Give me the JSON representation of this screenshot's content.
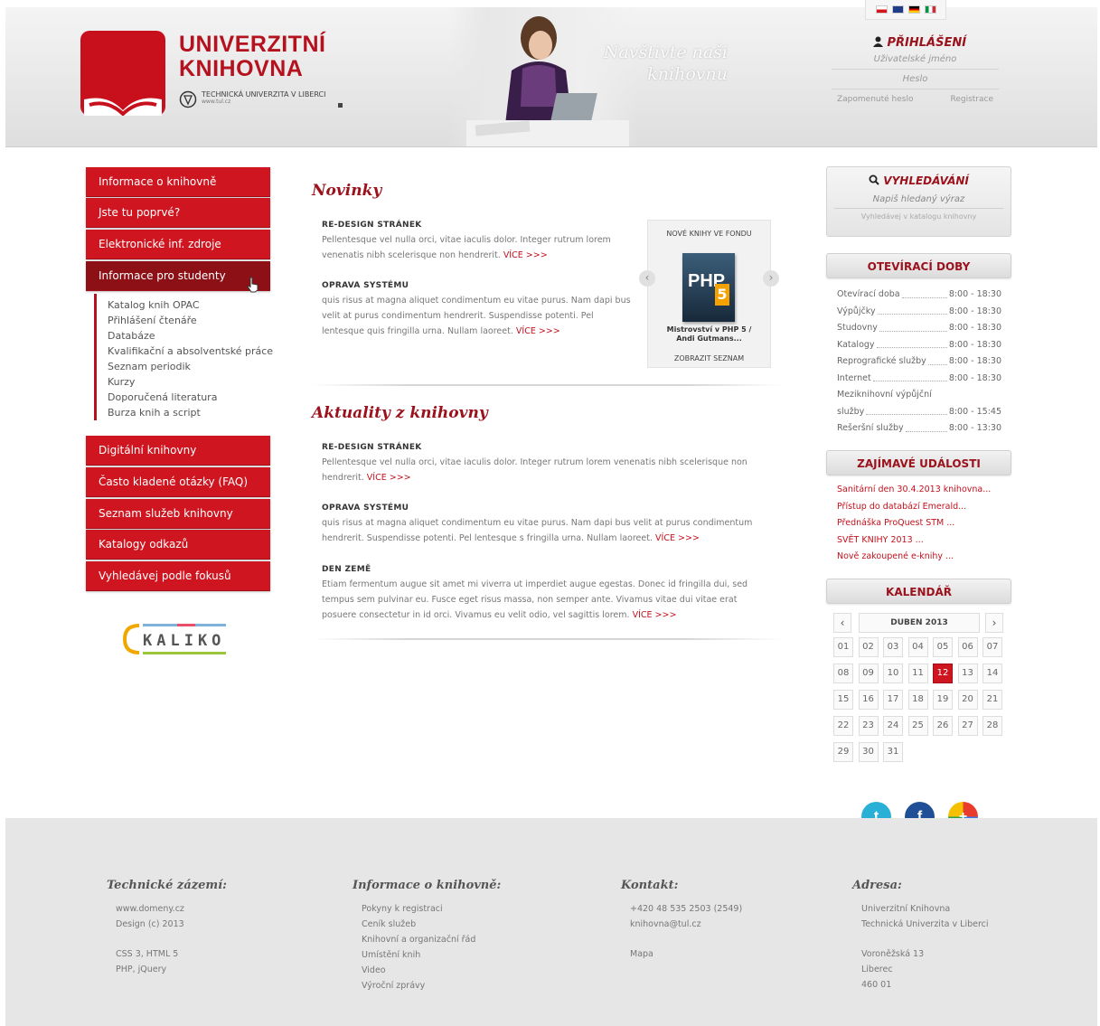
{
  "header": {
    "logo_line1": "UNIVERZITNÍ",
    "logo_line2": "KNIHOVNA",
    "tul_name": "TECHNICKÁ UNIVERZITA V LIBERCI",
    "tul_url": "www.tul.cz",
    "hero_line1": "Navštivte naši",
    "hero_line2": "knihovnu",
    "login_title": "PŘIHLÁŠENÍ",
    "username_placeholder": "Uživatelské jméno",
    "password_placeholder": "Heslo",
    "forgot_link": "Zapomenuté heslo",
    "register_link": "Registrace"
  },
  "sidebar": {
    "top_items": [
      {
        "label": "Informace o knihovně"
      },
      {
        "label": "Jste tu poprvé?"
      },
      {
        "label": "Elektronické inf. zdroje"
      },
      {
        "label": "Informace pro studenty"
      }
    ],
    "sub_items": [
      {
        "label": "Katalog knih OPAC"
      },
      {
        "label": "Přihlášení čtenáře"
      },
      {
        "label": "Databáze"
      },
      {
        "label": "Kvalifikační a absolventské práce"
      },
      {
        "label": "Seznam periodik"
      },
      {
        "label": "Kurzy"
      },
      {
        "label": "Doporučená literatura"
      },
      {
        "label": "Burza knih a script"
      }
    ],
    "bottom_items": [
      {
        "label": "Digitální knihovny"
      },
      {
        "label": "Často kladené otázky (FAQ)"
      },
      {
        "label": "Seznam služeb knihovny"
      },
      {
        "label": "Katalogy odkazů"
      },
      {
        "label": "Vyhledávej podle fokusů"
      }
    ],
    "kaliko": "KALIKO"
  },
  "news": {
    "title": "Novinky",
    "articles": [
      {
        "heading": "RE-DESIGN STRÁNEK",
        "text": "Pellentesque vel nulla orci, vitae iaculis dolor. Integer rutrum lorem venenatis nibh scelerisque non hendrerit.",
        "more": "VÍCE >>>"
      },
      {
        "heading": "OPRAVA SYSTÉMU",
        "text": "quis risus at magna aliquet condimentum eu vitae purus. Nam dapi bus velit at purus condimentum hendrerit. Suspendisse potenti. Pel lentesque quis fringilla urna. Nullam laoreet.",
        "more": "VÍCE >>>"
      }
    ],
    "book_box_title": "NOVÉ KNIHY VE FONDU",
    "book_cover_text": "PHP",
    "book_cover_num": "5",
    "book_caption_1": "Mistrovství v PHP 5 /",
    "book_caption_2": "Andi Gutmans...",
    "book_list_link": "ZOBRAZIT SEZNAM"
  },
  "updates": {
    "title": "Aktuality z knihovny",
    "articles": [
      {
        "heading": "RE-DESIGN STRÁNEK",
        "text": "Pellentesque vel nulla orci, vitae iaculis dolor. Integer rutrum lorem venenatis nibh scelerisque non hendrerit.",
        "more": "VÍCE >>>"
      },
      {
        "heading": "OPRAVA SYSTÉMU",
        "text": "quis risus at magna aliquet condimentum eu vitae purus. Nam dapi bus velit at purus condimentum hendrerit. Suspendisse potenti. Pel lentesque s fringilla urna. Nullam laoreet.",
        "more": "VÍCE >>>"
      },
      {
        "heading": "DEN ZEMĚ",
        "text": "Etiam fermentum augue sit amet mi viverra ut imperdiet augue egestas. Donec id fringilla dui, sed tempus sem pulvinar eu. Fusce eget risus massa, non semper ante. Vivamus vitae dui vitae erat posuere consectetur in id orci. Vivamus eu velit odio, vel sagittis lorem.",
        "more": "VÍCE >>>"
      }
    ]
  },
  "right": {
    "search_title": "VYHLEDÁVÁNÍ",
    "search_placeholder": "Napiš hledaný výraz",
    "search_sub": "Vyhledávej v katalogu knihovny",
    "hours_title": "OTEVÍRACÍ DOBY",
    "hours": [
      {
        "label": "Otevírací doba",
        "value": "8:00 - 18:30"
      },
      {
        "label": "Výpůjčky",
        "value": "8:00 - 18:30"
      },
      {
        "label": "Studovny",
        "value": "8:00 - 18:30"
      },
      {
        "label": "Katalogy",
        "value": "8:00 - 18:30"
      },
      {
        "label": "Reprografické služby",
        "value": "8:00 - 18:30"
      },
      {
        "label": "Internet",
        "value": "8:00 - 18:30"
      },
      {
        "label": "Meziknihovní výpůjční",
        "value": ""
      },
      {
        "label": "služby",
        "value": "8:00 - 15:45"
      },
      {
        "label": "Rešeršní služby",
        "value": "8:00 - 13:30"
      }
    ],
    "events_title": "ZAJÍMAVÉ UDÁLOSTI",
    "events": [
      {
        "label": "Sanitární den 30.4.2013 knihovna..."
      },
      {
        "label": "Přístup do databází Emerald..."
      },
      {
        "label": "Přednáška ProQuest STM ..."
      },
      {
        "label": "SVĚT KNIHY 2013 ..."
      },
      {
        "label": "Nově zakoupené e-knihy ..."
      }
    ],
    "calendar_title": "KALENDÁŘ",
    "calendar_month": "DUBEN 2013",
    "calendar_prev": "‹",
    "calendar_next": "›",
    "days": [
      "01",
      "02",
      "03",
      "04",
      "05",
      "06",
      "07",
      "08",
      "09",
      "10",
      "11",
      "12",
      "13",
      "14",
      "15",
      "16",
      "17",
      "18",
      "19",
      "20",
      "21",
      "22",
      "23",
      "24",
      "25",
      "26",
      "27",
      "28",
      "29",
      "30",
      "31"
    ],
    "today": "12"
  },
  "social": {
    "twitter_glyph": "t",
    "facebook_glyph": "f",
    "google_glyph": "+"
  },
  "footer": {
    "col1": {
      "title": "Technické zázemí:",
      "lines": [
        "www.domeny.cz",
        "Design (c) 2013",
        "",
        "CSS 3, HTML 5",
        "PHP, jQuery"
      ]
    },
    "col2": {
      "title": "Informace o knihovně:",
      "lines": [
        "Pokyny k registraci",
        "Ceník služeb",
        "Knihovní a organizační řád",
        "Umístění knih",
        "Video",
        "Výroční zprávy"
      ]
    },
    "col3": {
      "title": "Kontakt:",
      "lines": [
        "+420 48 535 2503 (2549)",
        "knihovna@tul.cz",
        "",
        "Mapa"
      ]
    },
    "col4": {
      "title": "Adresa:",
      "lines": [
        "Univerzitní Knihovna",
        "Technická Univerzita v Liberci",
        "",
        "Voroněžská 13",
        "Liberec",
        "460 01"
      ]
    }
  },
  "colors": {
    "brand_red": "#cf1620",
    "dark_red": "#9b111c"
  }
}
